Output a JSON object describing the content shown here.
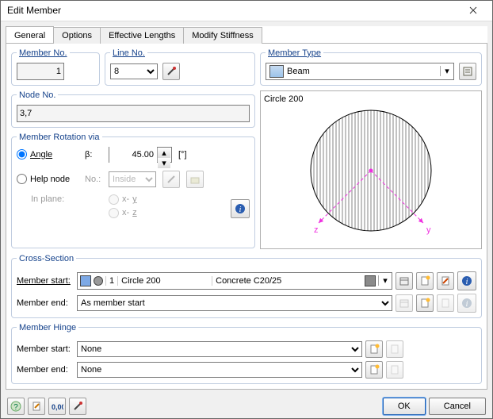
{
  "window": {
    "title": "Edit Member"
  },
  "tabs": [
    "General",
    "Options",
    "Effective Lengths",
    "Modify Stiffness"
  ],
  "general": {
    "memberNo": {
      "legend": "Member No.",
      "value": "1"
    },
    "lineNo": {
      "legend": "Line No.",
      "value": "8"
    },
    "memberType": {
      "legend": "Member Type",
      "value": "Beam"
    },
    "nodeNo": {
      "legend": "Node No.",
      "value": "3,7"
    },
    "rotation": {
      "legend": "Member Rotation via",
      "angle": {
        "label": "Angle",
        "symbol": "β:",
        "value": "45.00",
        "unit": "[°]"
      },
      "helpNode": {
        "label": "Help node",
        "no": "No.:",
        "option": "Inside"
      },
      "inPlane": {
        "label": "In plane:",
        "xy": "x-y",
        "xz": "x-z"
      }
    },
    "preview": {
      "title": "Circle 200",
      "zLabel": "z",
      "yLabel": "y"
    }
  },
  "crossSection": {
    "legend": "Cross-Section",
    "start": {
      "label": "Member start:",
      "index": "1",
      "name": "Circle 200",
      "material": "Concrete C20/25"
    },
    "end": {
      "label": "Member end:",
      "value": "As member start"
    }
  },
  "hinge": {
    "legend": "Member Hinge",
    "start": {
      "label": "Member start:",
      "value": "None"
    },
    "end": {
      "label": "Member end:",
      "value": "None"
    }
  },
  "footer": {
    "ok": "OK",
    "cancel": "Cancel"
  }
}
